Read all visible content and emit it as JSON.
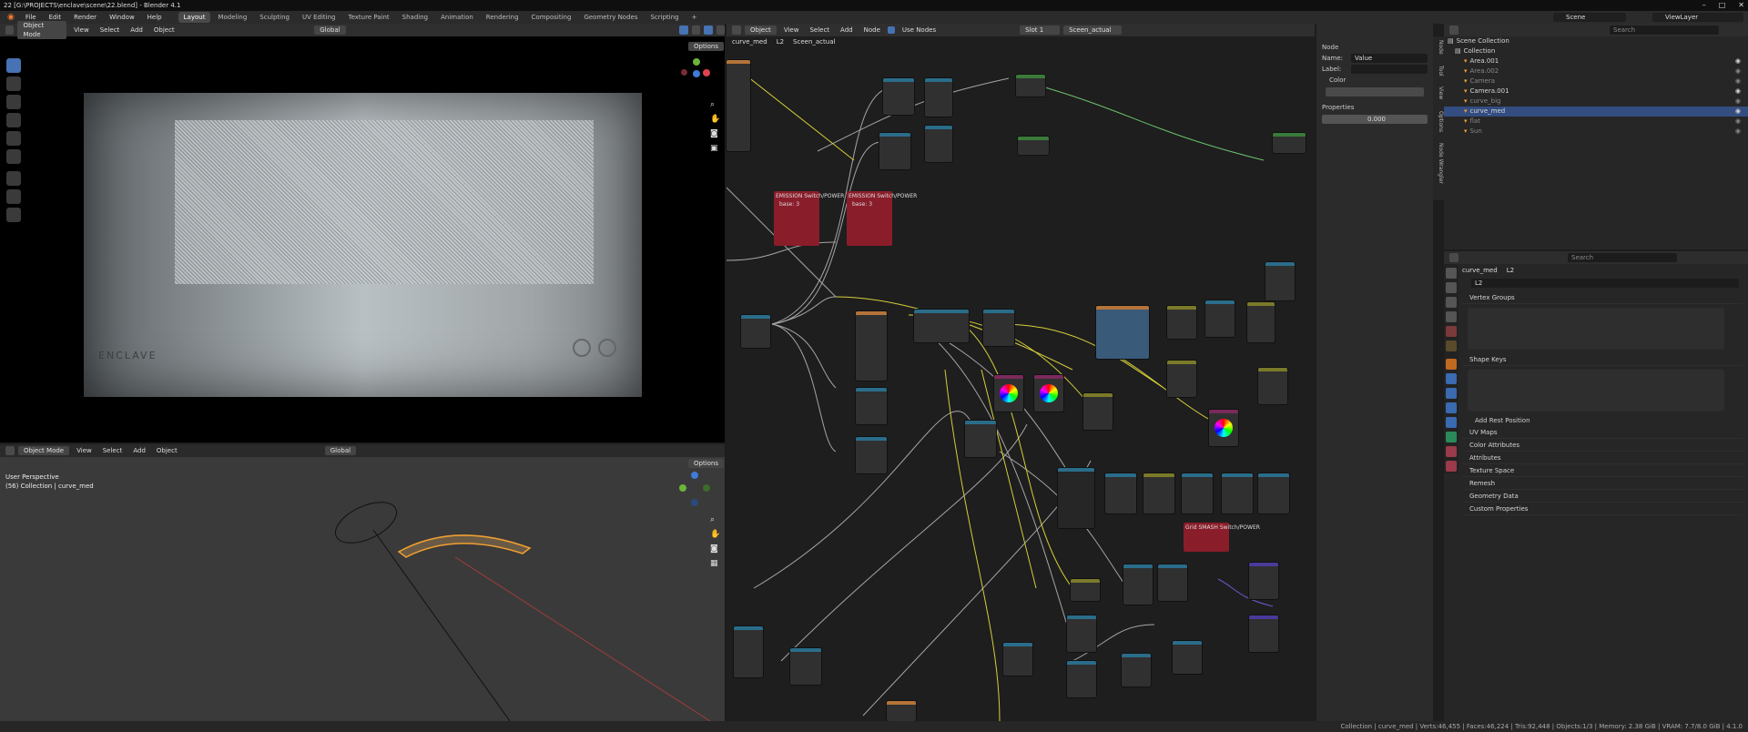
{
  "window": {
    "title": "22 [G:\\PROJECTS\\enclave\\scene\\22.blend] - Blender 4.1",
    "controls": [
      "–",
      "□",
      "✕"
    ]
  },
  "menu": [
    "File",
    "Edit",
    "Render",
    "Window",
    "Help"
  ],
  "workspaces": [
    "Layout",
    "Modeling",
    "Sculpting",
    "UV Editing",
    "Texture Paint",
    "Shading",
    "Animation",
    "Rendering",
    "Compositing",
    "Geometry Nodes",
    "Scripting"
  ],
  "active_workspace": "Layout",
  "workspace_add": "+",
  "scene": {
    "label": "Scene",
    "viewlayer": "ViewLayer"
  },
  "viewport1": {
    "mode": "Object Mode",
    "menus": [
      "View",
      "Select",
      "Add",
      "Object"
    ],
    "orientation": "Global",
    "options": "Options",
    "screen": {
      "brand": "ENCLAVE"
    }
  },
  "viewport2": {
    "mode": "Object Mode",
    "menus": [
      "View",
      "Select",
      "Add",
      "Object"
    ],
    "orientation": "Global",
    "options": "Options",
    "overlay_line1": "User Perspective",
    "overlay_line2": "(56) Collection | curve_med"
  },
  "node_editor": {
    "type": "Object",
    "menus": [
      "View",
      "Select",
      "Add",
      "Node"
    ],
    "use_nodes": "Use Nodes",
    "slot": "Slot 1",
    "material": "Sceen_actual",
    "breadcrumb": [
      "curve_med",
      "L2",
      "Sceen_actual"
    ],
    "frames": [
      {
        "label": "EMISSION Switch/POWER",
        "sub": "base: 3"
      },
      {
        "label": "EMISSION Switch/POWER",
        "sub": "base: 3"
      },
      {
        "label": "Grid SMASH Switch/POWER",
        "sub": ""
      }
    ]
  },
  "npanel": {
    "section_node": "Node",
    "name_label": "Name:",
    "name_value": "Value",
    "label_label": "Label:",
    "label_value": "",
    "color_label": "Color",
    "section_properties": "Properties",
    "value": "0.000",
    "tabs": [
      "Node",
      "Tool",
      "View",
      "Options",
      "Node Wrangler"
    ]
  },
  "outliner": {
    "search_placeholder": "Search",
    "root": "Scene Collection",
    "collection": "Collection",
    "items": [
      {
        "name": "Area.001",
        "selected": false,
        "dim": false
      },
      {
        "name": "Area.002",
        "selected": false,
        "dim": true
      },
      {
        "name": "Camera",
        "selected": false,
        "dim": true
      },
      {
        "name": "Camera.001",
        "selected": false,
        "dim": false
      },
      {
        "name": "curve_big",
        "selected": false,
        "dim": true
      },
      {
        "name": "curve_med",
        "selected": true,
        "dim": false
      },
      {
        "name": "flat",
        "selected": false,
        "dim": true
      },
      {
        "name": "Sun",
        "selected": false,
        "dim": true
      }
    ]
  },
  "properties": {
    "search_placeholder": "Search",
    "breadcrumb_object": "curve_med",
    "breadcrumb_data": "L2",
    "data_name": "L2",
    "sections": [
      "Vertex Groups",
      "Shape Keys",
      "UV Maps",
      "Color Attributes",
      "Attributes",
      "Texture Space",
      "Remesh",
      "Geometry Data",
      "Custom Properties"
    ],
    "add_rest_position": "Add Rest Position"
  },
  "statusbar": {
    "text": "Collection | curve_med | Verts:46,455 | Faces:46,224 | Tris:92,448 | Objects:1/3 | Memory: 2.38 GiB | VRAM: 7.7/8.0 GiB | 4.1.0"
  },
  "colors": {
    "accent": "#4772b3",
    "selection": "#334d80",
    "orange": "#f0a030",
    "frame_red": "#8a1d2a"
  }
}
